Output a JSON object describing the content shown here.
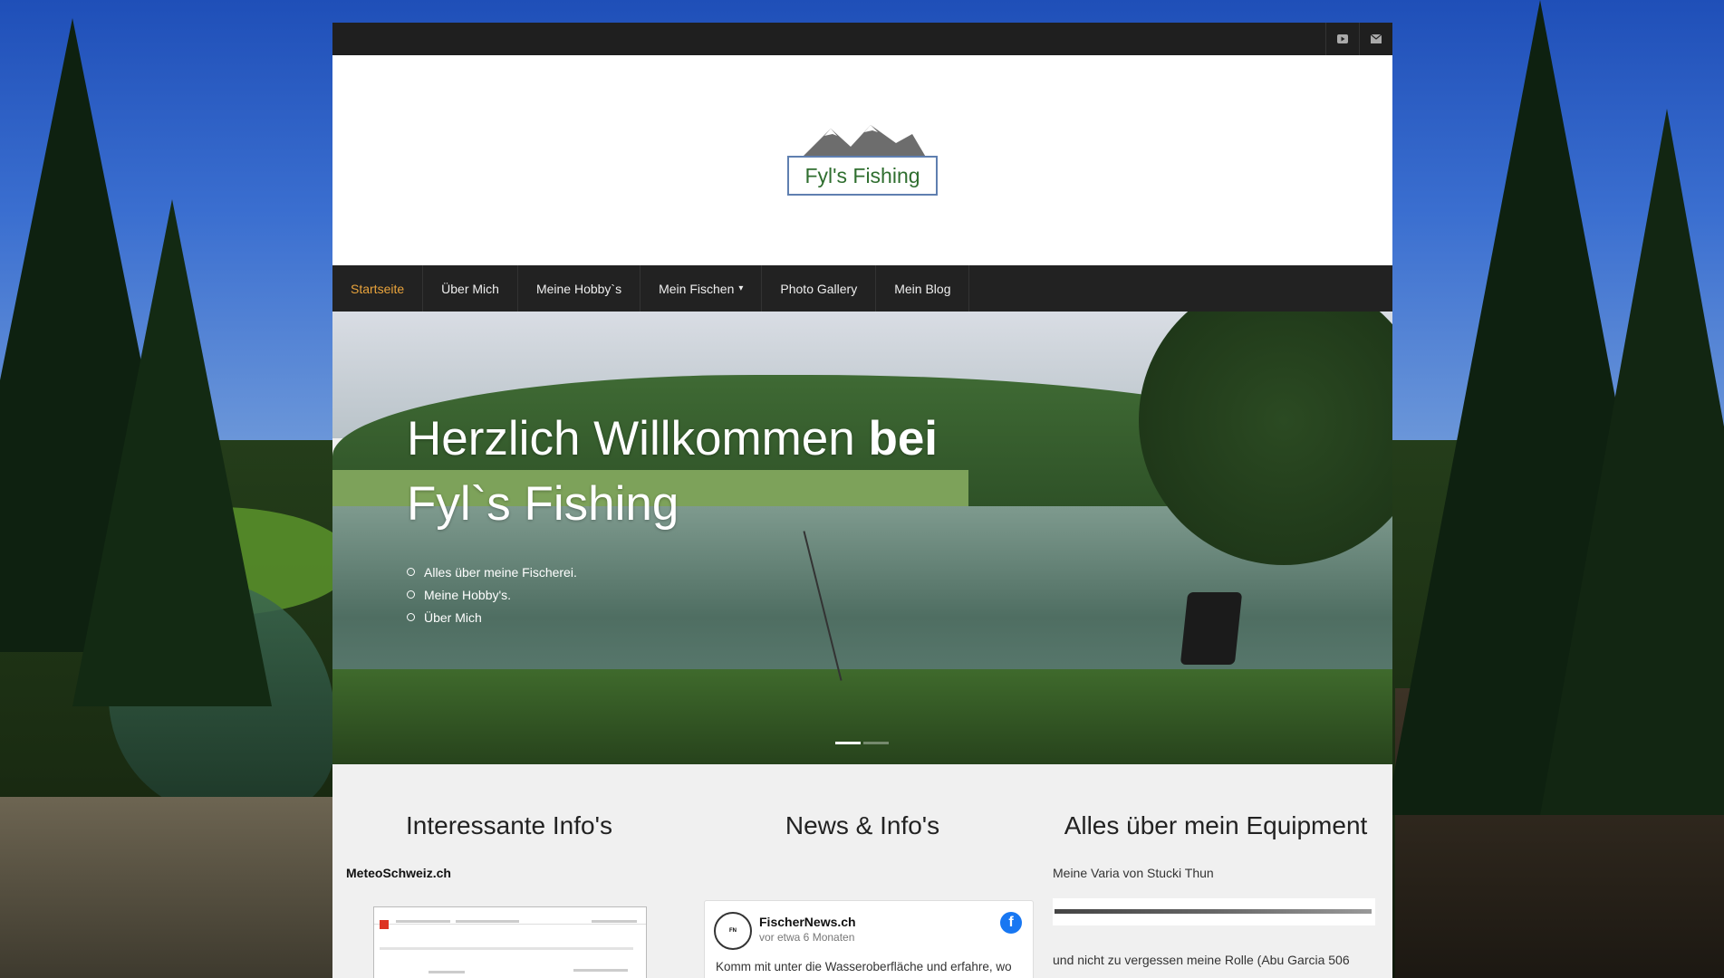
{
  "social": {
    "youtube_icon": "youtube-icon",
    "mail_icon": "envelope-icon"
  },
  "logo": {
    "text": "Fyl's Fishing"
  },
  "nav": {
    "items": [
      {
        "label": "Startseite",
        "active": true
      },
      {
        "label": "Über Mich"
      },
      {
        "label": "Meine Hobby`s"
      },
      {
        "label": "Mein Fischen",
        "has_dropdown": true
      },
      {
        "label": "Photo Gallery"
      },
      {
        "label": "Mein Blog"
      }
    ]
  },
  "hero": {
    "title_light": "Herzlich Willkommen ",
    "title_bold": "bei",
    "title_line2": "Fyl`s Fishing",
    "list": [
      "Alles über meine Fischerei.",
      "Meine Hobby's.",
      "Über Mich"
    ],
    "slides_total": 2,
    "active_slide": 1
  },
  "columns": {
    "c1": {
      "heading": "Interessante Info's",
      "subheading": "MeteoSchweiz.ch"
    },
    "c2": {
      "heading": "News & Info's",
      "post": {
        "page_name": "FischerNews.ch",
        "time": "vor etwa 6 Monaten",
        "text": "Komm mit unter die Wasseroberfläche und erfahre, wo die Fische stehen, wie sie sich verhalten! Wo? Natürlich auf meinem YouTube-Kanal «Fischernews»."
      }
    },
    "c3": {
      "heading": "Alles über mein Equipment",
      "line1": "Meine Varia von Stucki Thun",
      "line2": "und nicht zu vergessen meine Rolle (Abu Garcia 506"
    }
  }
}
